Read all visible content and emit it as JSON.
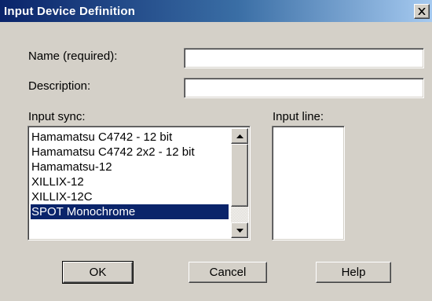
{
  "window": {
    "title": "Input Device Definition",
    "close_label": "X"
  },
  "fields": {
    "name_label": "Name (required):",
    "name_value": "",
    "description_label": "Description:",
    "description_value": ""
  },
  "input_sync": {
    "label": "Input sync:",
    "items": [
      "Hamamatsu C4742 - 12 bit",
      "Hamamatsu C4742 2x2 - 12 bit",
      "Hamamatsu-12",
      "XILLIX-12",
      "XILLIX-12C",
      "SPOT Monochrome"
    ],
    "selected": "SPOT Monochrome"
  },
  "input_line": {
    "label": "Input line:",
    "items": []
  },
  "buttons": {
    "ok": "OK",
    "cancel": "Cancel",
    "help": "Help"
  },
  "colors": {
    "selection": "#0a246a",
    "face": "#d4d0c8",
    "title_start": "#0a246a"
  }
}
